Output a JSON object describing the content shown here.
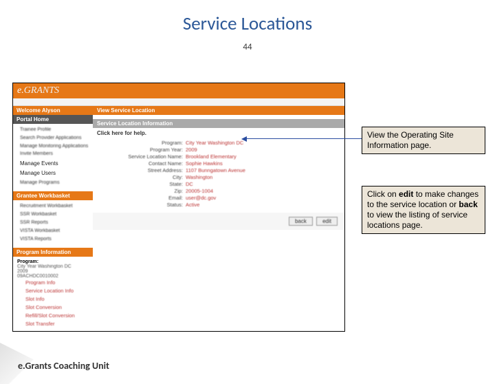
{
  "slide": {
    "title": "Service Locations",
    "num": "44"
  },
  "logo": {
    "a": "e.",
    "b": "GRANTS"
  },
  "welcome": "Welcome Alyson",
  "portal_home": "Portal Home",
  "nav": {
    "i0": "Trainee Profile",
    "i1": "Search Provider Applications",
    "i2": "Manage Monitoring Applications",
    "i3": "Invite Members",
    "manage_events": "Manage Events",
    "manage_users": "Manage Users",
    "i5": "Manage Programs"
  },
  "gw_head": "Grantee Workbasket",
  "gw": {
    "i0": "Recruitment Workbasket",
    "i1": "SSR Workbasket",
    "i2": "SSR Reports",
    "i3": "VISTA Workbasket",
    "i4": "VISTA Reports"
  },
  "prog_head": "Program Information",
  "prog": {
    "lbl": "Program:",
    "v0": "City Year Washington DC",
    "v1": "2009",
    "v2": "09ACHDC0010002"
  },
  "proglinks": {
    "l0": "Program Info",
    "l1": "Service Location Info",
    "l2": "Slot Info",
    "l3": "Slot Conversion",
    "l4": "Refill/Slot Conversion",
    "l5": "Slot Transfer"
  },
  "main": {
    "title": "View Service Location",
    "section": "Service Location Information",
    "help": "Click here for help."
  },
  "info": {
    "program_k": "Program:",
    "program_v": "City Year Washington DC",
    "year_k": "Program Year:",
    "year_v": "2009",
    "loc_k": "Service Location Name:",
    "loc_v": "Brookland Elementary",
    "contact_k": "Contact Name:",
    "contact_v": "Sophie Hawkins",
    "street_k": "Street Address:",
    "street_v": "1107 Bunngatown Avenue",
    "city_k": "City:",
    "city_v": "Washington",
    "state_k": "State:",
    "state_v": "DC",
    "zip_k": "Zip:",
    "zip_v": "20005-1004",
    "email_k": "Email:",
    "email_v": "user@dc.gov",
    "status_k": "Status:",
    "status_v": "Active"
  },
  "btn_back": "back",
  "btn_edit": "edit",
  "callout1": "View the Operating Site Information page.",
  "callout2_a": "Click on ",
  "callout2_b": "edit",
  "callout2_c": " to make changes to the service location or ",
  "callout2_d": "back",
  "callout2_e": " to view the listing of service locations page.",
  "footer": "e.Grants Coaching Unit"
}
